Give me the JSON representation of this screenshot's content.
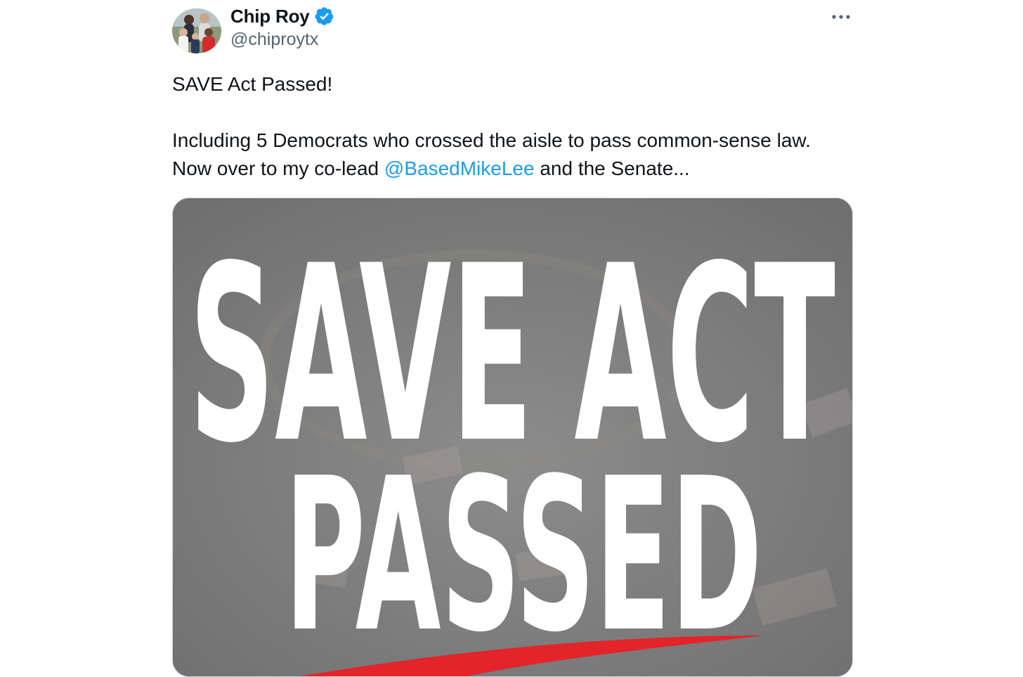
{
  "tweet": {
    "author": {
      "display_name": "Chip Roy",
      "handle": "@chiproytx",
      "verified": true,
      "verified_icon": "verified-badge-icon",
      "avatar_alt": "profile photo"
    },
    "more_icon": "more-horizontal-icon",
    "text": {
      "line1": "SAVE Act Passed!",
      "body_before_mention": "Including 5 Democrats who crossed the aisle to pass common-sense law. Now over to my co-lead ",
      "mention": "@BasedMikeLee",
      "body_after_mention": " and the Senate..."
    },
    "media": {
      "headline_line1": "SAVE ACT",
      "headline_line2": "PASSED",
      "underline_color": "#e3242b",
      "overlay_color": "#7c7c7c"
    }
  },
  "colors": {
    "link": "#1d9bf0",
    "secondary_text": "#536471",
    "verified": "#1d9bf0"
  }
}
